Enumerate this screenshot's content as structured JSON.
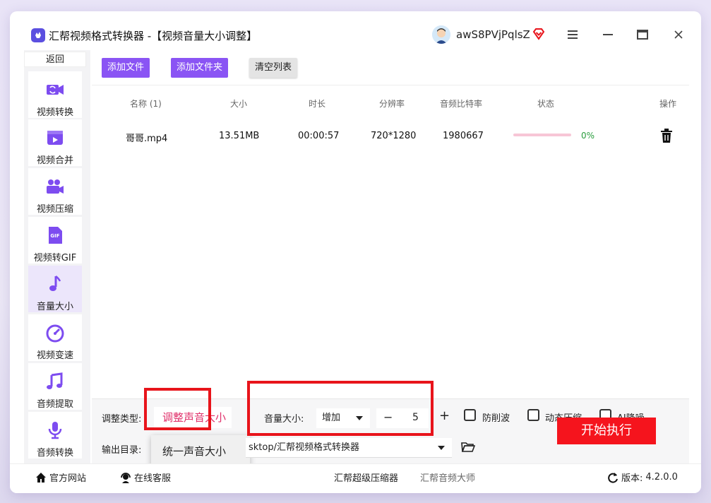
{
  "window": {
    "title": "汇帮视频格式转换器  -【视频音量大小调整】",
    "username": "awS8PVjPqlsZ",
    "controls": [
      "menu-icon",
      "maximize-icon",
      "close-icon"
    ]
  },
  "sidebar": {
    "back_label": "返回",
    "items": [
      {
        "label": "视频转换",
        "icon": "video-convert-icon"
      },
      {
        "label": "视频合并",
        "icon": "video-merge-icon"
      },
      {
        "label": "视频压缩",
        "icon": "video-compress-icon"
      },
      {
        "label": "视频转GIF",
        "icon": "gif-icon"
      },
      {
        "label": "音量大小",
        "icon": "music-note-icon",
        "active": true
      },
      {
        "label": "视频变速",
        "icon": "speedometer-icon"
      },
      {
        "label": "音频提取",
        "icon": "audio-extract-icon"
      },
      {
        "label": "音频转换",
        "icon": "microphone-icon"
      }
    ]
  },
  "toolbar": {
    "add_file": "添加文件",
    "add_folder": "添加文件夹",
    "clear_list": "清空列表"
  },
  "table": {
    "headers": [
      "名称 (1)",
      "大小",
      "时长",
      "分辨率",
      "音频比特率",
      "状态",
      "操作"
    ],
    "rows": [
      {
        "name": "哥哥.mp4",
        "size": "13.51MB",
        "duration": "00:00:57",
        "resolution": "720*1280",
        "bitrate": "1980667",
        "progress": "0%"
      }
    ]
  },
  "controls": {
    "adjust_type_label": "调整类型:",
    "adjust_type_value": "调整声音大小",
    "adjust_type_option": "统一声音大小",
    "volume_label": "音量大小:",
    "volume_direction": "增加",
    "volume_value": "5",
    "minus": "−",
    "plus": "+",
    "anti_clip_label": "防削波",
    "dynamic_compress_label": "动态压缩",
    "ai_denoise_label": "AI降噪",
    "output_label": "输出目录:",
    "output_path": "sktop/汇帮视频格式转换器",
    "start_button": "开始执行"
  },
  "statusbar": {
    "website": "官方网站",
    "support": "在线客服",
    "compressor": "汇帮超级压缩器",
    "audio_master": "汇帮音频大师",
    "version_label": "版本:",
    "version": "4.2.0.0"
  },
  "colors": {
    "accent_purple": "#8a54f4",
    "start_red": "#f5141d",
    "highlight_red": "#e8141b",
    "selected_pink": "#e0306a",
    "progress_green": "#2a9d3e"
  }
}
